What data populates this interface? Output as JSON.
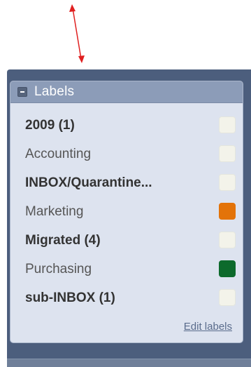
{
  "panel": {
    "title": "Labels",
    "edit_link": "Edit labels"
  },
  "labels": [
    {
      "name": "2009",
      "count": "(1)",
      "bold": true,
      "color": "#f3f3ea"
    },
    {
      "name": "Accounting",
      "count": "",
      "bold": false,
      "color": "#f3f3ea"
    },
    {
      "name": "INBOX/Quarantine...",
      "count": "",
      "bold": true,
      "color": "#f3f3ea"
    },
    {
      "name": "Marketing",
      "count": "",
      "bold": false,
      "color": "#e37309"
    },
    {
      "name": "Migrated",
      "count": "(4)",
      "bold": true,
      "color": "#f3f3ea"
    },
    {
      "name": "Purchasing",
      "count": "",
      "bold": false,
      "color": "#0d6a2c"
    },
    {
      "name": "sub-INBOX",
      "count": "(1)",
      "bold": true,
      "color": "#f3f3ea"
    }
  ],
  "colors": {
    "arrow": "#e02020",
    "panel_bg": "#4c5e7d",
    "header_bg": "#8c9cb8",
    "box_bg": "#dde3ef"
  }
}
